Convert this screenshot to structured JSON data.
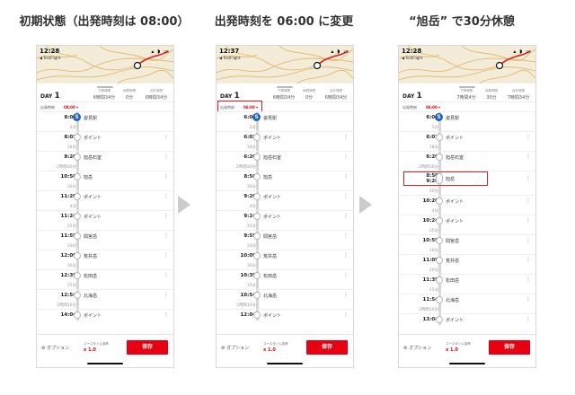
{
  "titles": [
    "初期状態（出発時刻は 08:00）",
    "出発時刻を 06:00 に変更",
    "“旭岳” で30分休憩"
  ],
  "panels": [
    {
      "clock": "12:28",
      "testflight": "◀ TestFlight",
      "day_label": "DAY",
      "day_num": "1",
      "summary": [
        {
          "label": "下降時間",
          "value": "6時間34分"
        },
        {
          "label": "休憩時間",
          "value": "0分"
        },
        {
          "label": "合計時間",
          "value": "6時間34分"
        }
      ],
      "departure_label": "出発時刻",
      "departure_value": "08:00",
      "rows": [
        {
          "kind": "stop",
          "time": "8:00",
          "name": "姿見駅",
          "marker": "S"
        },
        {
          "kind": "dur",
          "text": "2分"
        },
        {
          "kind": "stop",
          "time": "8:02",
          "name": "ポイント"
        },
        {
          "kind": "dur",
          "text": "18分"
        },
        {
          "kind": "stop",
          "time": "8:20",
          "name": "旭岳石室"
        },
        {
          "kind": "dur",
          "text": "2時間30分"
        },
        {
          "kind": "stop",
          "time": "10:50",
          "name": "旭岳"
        },
        {
          "kind": "dur",
          "text": "30分"
        },
        {
          "kind": "stop",
          "time": "11:20",
          "name": "ポイント"
        },
        {
          "kind": "dur",
          "text": "4分"
        },
        {
          "kind": "stop",
          "time": "11:24",
          "name": "ポイント"
        },
        {
          "kind": "dur",
          "text": "35分"
        },
        {
          "kind": "stop",
          "time": "11:59",
          "name": "間宮岳"
        },
        {
          "kind": "dur",
          "text": "10分"
        },
        {
          "kind": "stop",
          "time": "12:09",
          "name": "荒井岳"
        },
        {
          "kind": "dur",
          "text": "30分"
        },
        {
          "kind": "stop",
          "time": "12:39",
          "name": "松田岳"
        },
        {
          "kind": "dur",
          "text": "15分"
        },
        {
          "kind": "stop",
          "time": "12:54",
          "name": "北海岳"
        },
        {
          "kind": "dur",
          "text": "1時間10分"
        },
        {
          "kind": "stop",
          "time": "14:04",
          "name": "ポイント"
        }
      ],
      "option_label": "オプション",
      "coursetime_label": "コースタイム倍率",
      "coursetime_value": "x 1.0",
      "save_label": "保存"
    },
    {
      "clock": "12:37",
      "testflight": "◀ TestFlight",
      "day_label": "DAY",
      "day_num": "1",
      "summary": [
        {
          "label": "下降時間",
          "value": "6時間34分"
        },
        {
          "label": "休憩時間",
          "value": "0分"
        },
        {
          "label": "合計時間",
          "value": "6時間34分"
        }
      ],
      "departure_label": "出発時刻",
      "departure_value": "06:00",
      "rows": [
        {
          "kind": "stop",
          "time": "6:00",
          "name": "姿見駅",
          "marker": "S"
        },
        {
          "kind": "dur",
          "text": "2分"
        },
        {
          "kind": "stop",
          "time": "6:02",
          "name": "ポイント"
        },
        {
          "kind": "dur",
          "text": "18分"
        },
        {
          "kind": "stop",
          "time": "6:20",
          "name": "旭岳石室"
        },
        {
          "kind": "dur",
          "text": "2時間30分"
        },
        {
          "kind": "stop",
          "time": "8:50",
          "name": "旭岳"
        },
        {
          "kind": "dur",
          "text": "30分"
        },
        {
          "kind": "stop",
          "time": "9:20",
          "name": "ポイント"
        },
        {
          "kind": "dur",
          "text": "4分"
        },
        {
          "kind": "stop",
          "time": "9:24",
          "name": "ポイント"
        },
        {
          "kind": "dur",
          "text": "35分"
        },
        {
          "kind": "stop",
          "time": "9:59",
          "name": "間宮岳"
        },
        {
          "kind": "dur",
          "text": "10分"
        },
        {
          "kind": "stop",
          "time": "10:09",
          "name": "荒井岳"
        },
        {
          "kind": "dur",
          "text": "30分"
        },
        {
          "kind": "stop",
          "time": "10:39",
          "name": "松田岳"
        },
        {
          "kind": "dur",
          "text": "15分"
        },
        {
          "kind": "stop",
          "time": "10:54",
          "name": "北海岳"
        },
        {
          "kind": "dur",
          "text": "1時間10分"
        },
        {
          "kind": "stop",
          "time": "12:04",
          "name": "ポイント"
        }
      ],
      "option_label": "オプション",
      "coursetime_label": "コースタイム倍率",
      "coursetime_value": "x 1.0",
      "save_label": "保存"
    },
    {
      "clock": "12:28",
      "testflight": "◀ TestFlight",
      "day_label": "DAY",
      "day_num": "1",
      "summary": [
        {
          "label": "下降時間",
          "value": "7時間4分"
        },
        {
          "label": "休憩時間",
          "value": "30分"
        },
        {
          "label": "合計時間",
          "value": "7時間34分"
        }
      ],
      "departure_label": "出発時刻",
      "departure_value": "06:00",
      "rows": [
        {
          "kind": "stop",
          "time": "6:00",
          "name": "姿見駅",
          "marker": "S"
        },
        {
          "kind": "dur",
          "text": "2分"
        },
        {
          "kind": "stop",
          "time": "6:02",
          "name": "ポイント"
        },
        {
          "kind": "dur",
          "text": "18分"
        },
        {
          "kind": "stop",
          "time": "6:20",
          "name": "旭岳石室"
        },
        {
          "kind": "dur",
          "text": "2時間30分"
        },
        {
          "kind": "stop2",
          "time": "8:50",
          "time2": "9:20",
          "name": "旭岳"
        },
        {
          "kind": "dur",
          "text": "30分"
        },
        {
          "kind": "stop",
          "time": "10:20",
          "name": "ポイント"
        },
        {
          "kind": "dur",
          "text": "4分"
        },
        {
          "kind": "stop",
          "time": "10:24",
          "name": "ポイント"
        },
        {
          "kind": "dur",
          "text": "35分"
        },
        {
          "kind": "stop",
          "time": "10:59",
          "name": "間宮岳"
        },
        {
          "kind": "dur",
          "text": "10分"
        },
        {
          "kind": "stop",
          "time": "11:09",
          "name": "荒井岳"
        },
        {
          "kind": "dur",
          "text": "30分"
        },
        {
          "kind": "stop",
          "time": "11:39",
          "name": "松田岳"
        },
        {
          "kind": "dur",
          "text": "15分"
        },
        {
          "kind": "stop",
          "time": "11:54",
          "name": "北海岳"
        },
        {
          "kind": "dur",
          "text": "1時間10分"
        },
        {
          "kind": "stop",
          "time": "13:04",
          "name": "ポイント"
        }
      ],
      "option_label": "オプション",
      "coursetime_label": "コースタイム倍率",
      "coursetime_value": "x 1.0",
      "save_label": "保存"
    }
  ],
  "colors": {
    "accent": "#e60012",
    "highlight": "#d42020",
    "start_marker": "#1e60c8",
    "map_bg": "#f3ecd9",
    "contour": "#e2b463",
    "route": "#e02020"
  },
  "icons": {
    "kebab": "⋮",
    "option": "⚙"
  }
}
